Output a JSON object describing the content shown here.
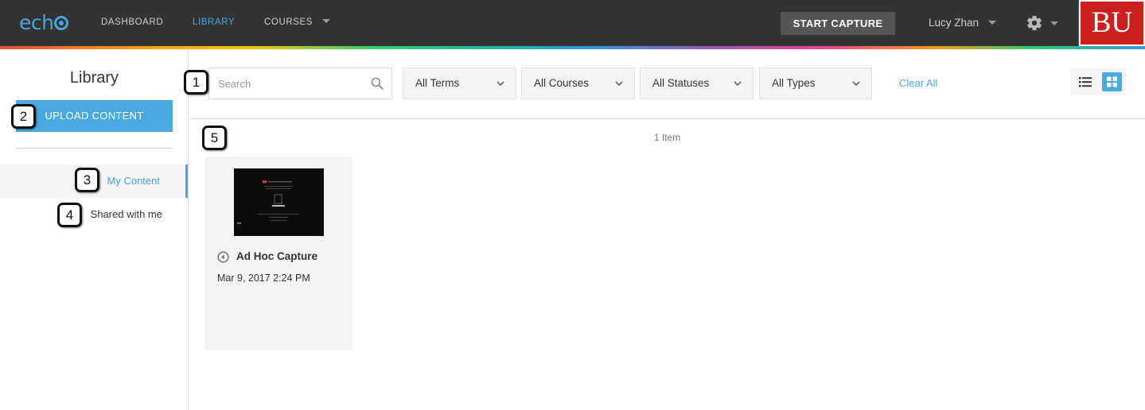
{
  "topbar": {
    "logo_text": "ech",
    "nav": [
      {
        "label": "DASHBOARD"
      },
      {
        "label": "LIBRARY"
      },
      {
        "label": "COURSES"
      }
    ],
    "start_capture_label": "START CAPTURE",
    "user_name": "Lucy Zhan",
    "brand_logo_text": "BU",
    "accent_color": "#4aa3df",
    "brand_color": "#cc1f1f"
  },
  "sidebar": {
    "title": "Library",
    "upload_label": "UPLOAD CONTENT",
    "items": [
      {
        "label": "My Content",
        "active": true
      },
      {
        "label": "Shared with me",
        "active": false
      }
    ]
  },
  "toolbar": {
    "search_placeholder": "Search",
    "filters": [
      {
        "label": "All Terms"
      },
      {
        "label": "All Courses"
      },
      {
        "label": "All Statuses"
      },
      {
        "label": "All Types"
      }
    ],
    "clear_all_label": "Clear All",
    "view_mode": "grid"
  },
  "content": {
    "count_label": "1 Item",
    "items": [
      {
        "title": "Ad Hoc Capture",
        "date": "Mar 9, 2017 2:24 PM",
        "icon": "play-circle-icon"
      }
    ]
  },
  "callouts": [
    "1",
    "2",
    "3",
    "4",
    "5"
  ]
}
